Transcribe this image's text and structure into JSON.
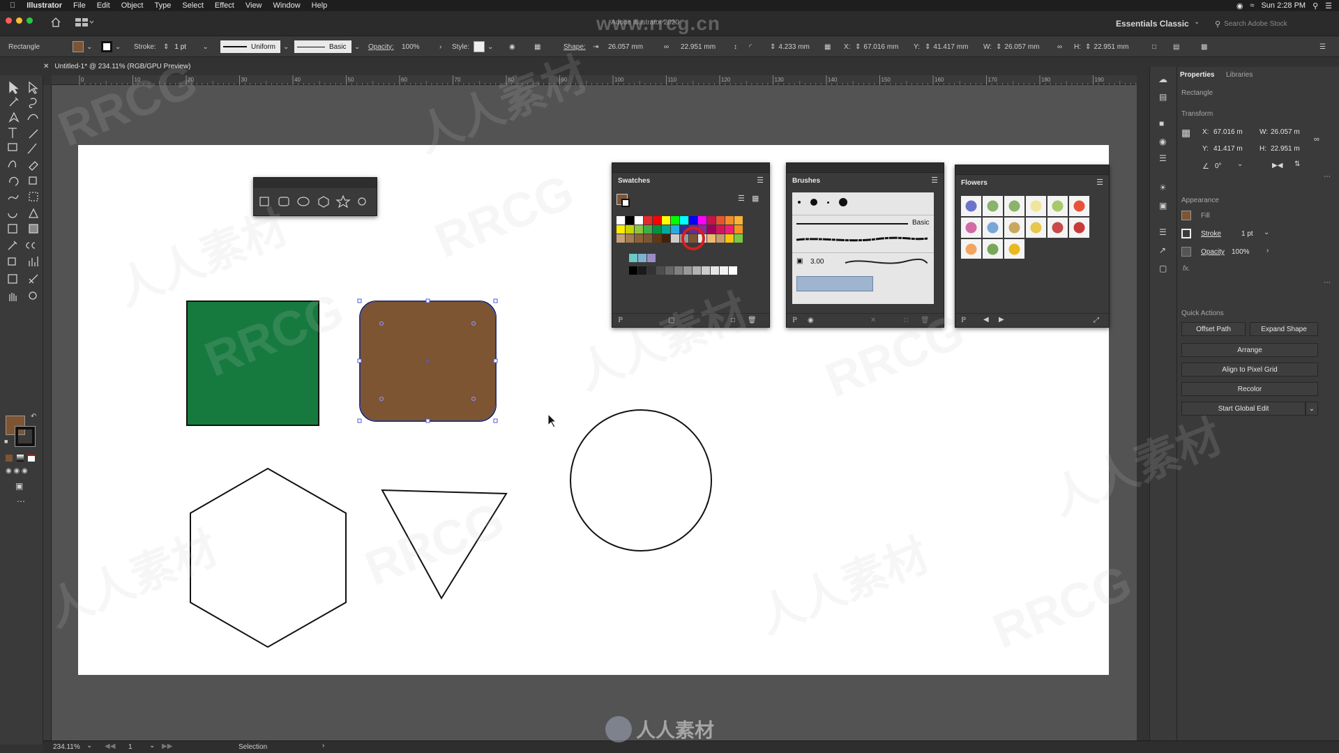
{
  "menubar": {
    "app": "Illustrator",
    "items": [
      "File",
      "Edit",
      "Object",
      "Type",
      "Select",
      "Effect",
      "View",
      "Window",
      "Help"
    ],
    "clock": "Sun 2:28 PM"
  },
  "appbar": {
    "title": "Adobe Illustrator 2020",
    "watermark_url": "www.rrcg.cn",
    "workspace": "Essentials Classic",
    "search_placeholder": "Search Adobe Stock"
  },
  "controlbar": {
    "selection_type": "Rectangle",
    "fill_color": "#7d5533",
    "stroke_label": "Stroke:",
    "stroke_weight": "1 pt",
    "profile": "Uniform",
    "brush": "Basic",
    "opacity_label": "Opacity:",
    "opacity": "100%",
    "style_label": "Style:",
    "shape_label": "Shape:",
    "shape_w": "26.057 mm",
    "shape_h": "22.951 mm",
    "corner": "4.233 mm",
    "x_label": "X:",
    "x": "67.016 mm",
    "y_label": "Y:",
    "y": "41.417 mm",
    "w_label": "W:",
    "w": "26.057 mm",
    "h_label": "H:",
    "h": "22.951 mm"
  },
  "document": {
    "tab": "Untitled-1* @ 234.11% (RGB/GPU Preview)",
    "ruler_marks": [
      "0",
      "10",
      "20",
      "30",
      "40",
      "50",
      "60",
      "70",
      "80",
      "90",
      "100",
      "110",
      "120",
      "130",
      "140",
      "150",
      "160",
      "170",
      "180",
      "190",
      "200"
    ]
  },
  "panels": {
    "swatches": {
      "title": "Swatches"
    },
    "brushes": {
      "title": "Brushes",
      "basic_label": "Basic",
      "size": "3.00"
    },
    "flowers": {
      "title": "Flowers"
    }
  },
  "properties": {
    "tab_properties": "Properties",
    "tab_libraries": "Libraries",
    "object_type": "Rectangle",
    "transform_header": "Transform",
    "x_label": "X:",
    "x": "67.016 m",
    "y_label": "Y:",
    "y": "41.417 m",
    "w_label": "W:",
    "w": "26.057 m",
    "h_label": "H:",
    "h": "22.951 m",
    "angle": "0°",
    "appearance_header": "Appearance",
    "fill_label": "Fill",
    "stroke_label": "Stroke",
    "stroke_value": "1 pt",
    "opacity_label": "Opacity",
    "opacity_value": "100%",
    "fx_label": "fx.",
    "quick_actions_header": "Quick Actions",
    "offset_path": "Offset Path",
    "expand_shape": "Expand Shape",
    "arrange": "Arrange",
    "align_pixel": "Align to Pixel Grid",
    "recolor": "Recolor",
    "global_edit": "Start Global Edit"
  },
  "statusbar": {
    "zoom": "234.11%",
    "artboard": "1",
    "tool": "Selection"
  },
  "colors": {
    "green_rect": "#167a3e",
    "brown_rect": "#7d5533",
    "selection": "#4d5bd6"
  },
  "watermark": {
    "latin": "RRCG",
    "cjk": "人人素材",
    "footer_logo": "人人素材"
  }
}
